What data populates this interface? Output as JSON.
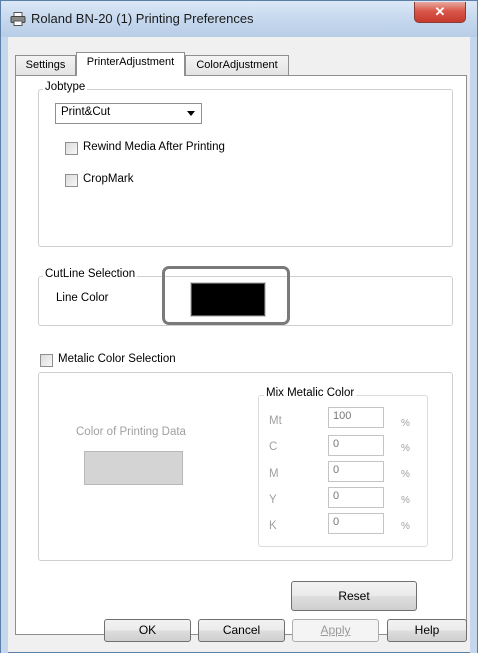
{
  "window": {
    "title": "Roland BN-20 (1) Printing Preferences",
    "close_glyph": "✕"
  },
  "tabs": [
    {
      "label": "Settings",
      "active": false
    },
    {
      "label": "PrinterAdjustment",
      "active": true
    },
    {
      "label": "ColorAdjustment",
      "active": false
    }
  ],
  "jobtype": {
    "legend": "Jobtype",
    "selected": "Print&Cut",
    "options": {
      "rewind": {
        "label": "Rewind Media After Printing",
        "checked": false
      },
      "cropmark": {
        "label": "CropMark",
        "checked": false
      }
    }
  },
  "cutline": {
    "legend": "CutLine Selection",
    "line_color_label": "Line Color",
    "line_color": "#000000"
  },
  "metallic": {
    "checkbox_label": "Metalic Color Selection",
    "checked": false,
    "color_of_printing_data_label": "Color of Printing Data",
    "mix": {
      "legend": "Mix Metalic Color",
      "rows": [
        {
          "label": "Mt",
          "value": "100",
          "unit": "%"
        },
        {
          "label": "C",
          "value": "0",
          "unit": "%"
        },
        {
          "label": "M",
          "value": "0",
          "unit": "%"
        },
        {
          "label": "Y",
          "value": "0",
          "unit": "%"
        },
        {
          "label": "K",
          "value": "0",
          "unit": "%"
        }
      ]
    }
  },
  "buttons": {
    "reset": "Reset",
    "ok": "OK",
    "cancel": "Cancel",
    "apply": "Apply",
    "help": "Help"
  },
  "colors": {
    "highlight_border": "#7a7a7a",
    "titlebar": "#c4d7ed",
    "close_button": "#d9574a"
  }
}
